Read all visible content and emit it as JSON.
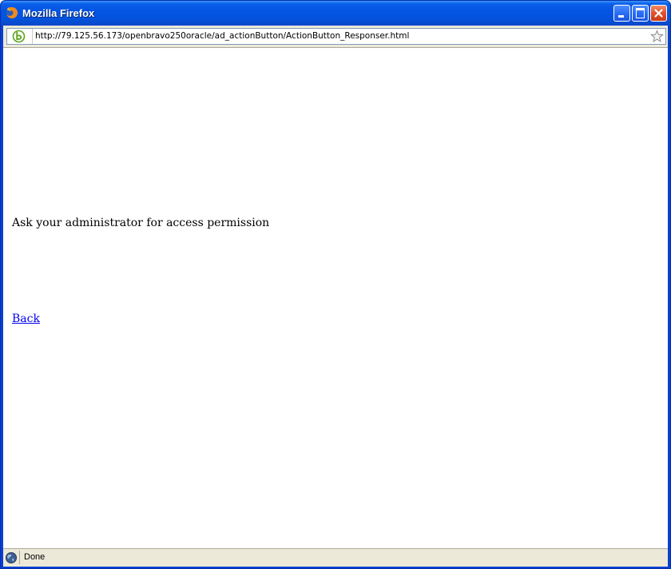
{
  "window": {
    "title": "Mozilla Firefox"
  },
  "addressbar": {
    "url": "http://79.125.56.173/openbravo250oracle/ad_actionButton/ActionButton_Responser.html",
    "site_icon": "openbravo-favicon-icon",
    "bookmark_icon": "star-icon"
  },
  "content": {
    "message": "Ask your administrator for access permission",
    "back_link": "Back"
  },
  "statusbar": {
    "status": "Done"
  },
  "colors": {
    "titlebar": "#0554e3",
    "link": "#0000ee",
    "chrome": "#ece9d8"
  }
}
